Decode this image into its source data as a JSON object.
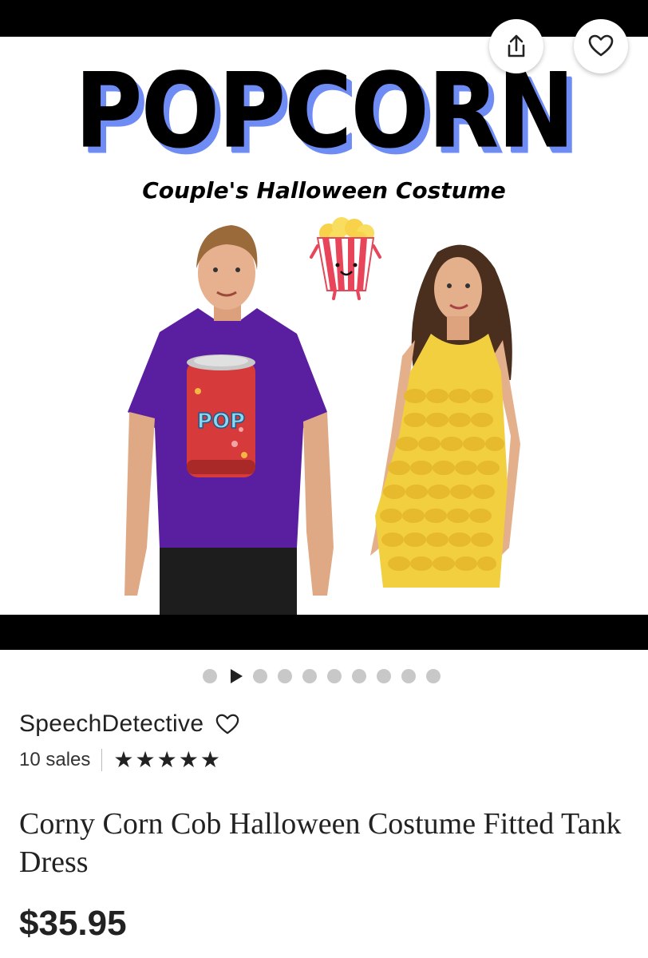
{
  "hero": {
    "headline": "POPCORN",
    "subheadline": "Couple's Halloween Costume",
    "can_label": "POP"
  },
  "carousel": {
    "total": 10,
    "active": 2
  },
  "shop": {
    "name": "SpeechDetective",
    "sales": "10 sales",
    "rating": 5
  },
  "listing": {
    "title": "Corny Corn Cob Halloween Costume Fitted Tank Dress",
    "price": "$35.95"
  },
  "colors": {
    "shirt": "#5a1fa0",
    "dress_yellow": "#f2cf3e",
    "headline_shadow": "#6f8cf5",
    "can_red": "#d63a3a"
  },
  "icons": [
    "share-icon",
    "heart-icon",
    "play-icon",
    "star-icon"
  ]
}
